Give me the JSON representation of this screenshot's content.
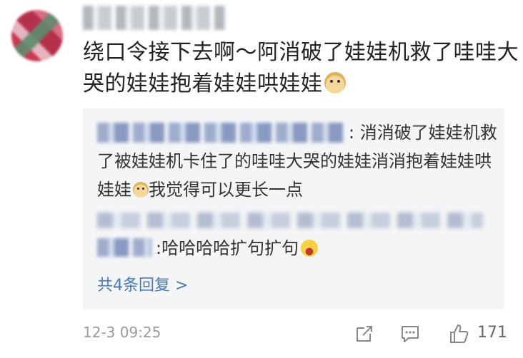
{
  "comment": {
    "avatar_icon": "user-avatar",
    "text": "绕口令接下去啊～阿消破了娃娃机救了哇哇大哭的娃娃抱着娃娃哄娃娃",
    "emoji": "doge"
  },
  "replies": [
    {
      "text": ": 消消破了娃娃机救了被娃娃机卡住了的哇哇大哭的娃娃消消抱着娃娃哄娃娃",
      "emoji": "doge",
      "text_after": "我觉得可以更长一点"
    },
    {
      "text": ":哈哈哈哈扩句扩句",
      "emoji": "laugh-cry"
    }
  ],
  "more_replies_label": "共4条回复 >",
  "footer": {
    "timestamp": "12-3 09:25",
    "like_count": "171",
    "icons": [
      "share-icon",
      "comment-icon",
      "like-icon"
    ]
  }
}
